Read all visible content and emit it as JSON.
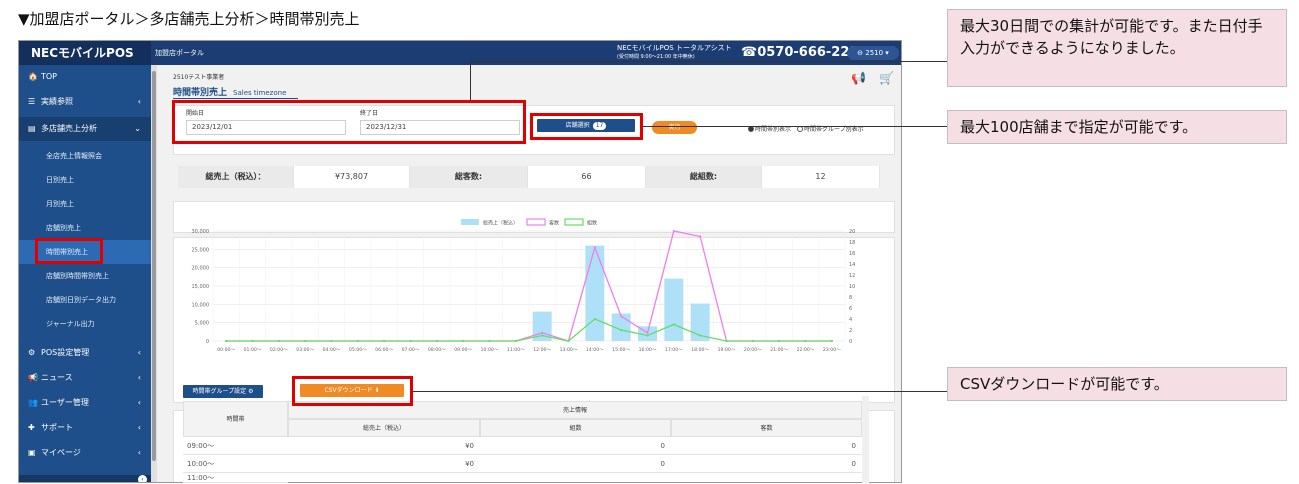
{
  "page_caption": "▼加盟店ポータル＞多店舗売上分析＞時間帯別売上",
  "app": {
    "brand": "NECモバイルPOS",
    "portal_label": "加盟店ポータル",
    "assist_title": "NECモバイルPOS トータルアシスト",
    "assist_sub": "(受付時間 9:00〜21:00 年中無休)",
    "phone": "☎0570-666-221",
    "user_menu": "⊖ 2510 ▾"
  },
  "sidebar": {
    "items": [
      {
        "icon": "🏠",
        "label": "TOP",
        "chevron": ""
      },
      {
        "icon": "☰",
        "label": "実績参照",
        "chevron": "‹"
      },
      {
        "icon": "▤",
        "label": "多店舗売上分析",
        "chevron": "⌄"
      },
      {
        "icon": "⚙",
        "label": "POS設定管理",
        "chevron": "‹"
      },
      {
        "icon": "📢",
        "label": "ニュース",
        "chevron": "‹"
      },
      {
        "icon": "👥",
        "label": "ユーザー管理",
        "chevron": "‹"
      },
      {
        "icon": "✚",
        "label": "サポート",
        "chevron": "‹"
      },
      {
        "icon": "▣",
        "label": "マイページ",
        "chevron": "‹"
      }
    ],
    "sub_items": [
      "全店売上情報照会",
      "日別売上",
      "月別売上",
      "店舗別売上",
      "時間帯別売上",
      "店舗別時間帯別売上",
      "店舗別日別データ出力",
      "ジャーナル出力"
    ],
    "collapse_icon": "‹"
  },
  "content": {
    "breadcrumb": "2510テスト事業者",
    "title": "時間帯別売上",
    "title_en": "Sales timezone",
    "start_label": "開始日",
    "start_value": "2023/12/01",
    "end_label": "終了日",
    "end_value": "2023/12/31",
    "store_button": "店舗選択",
    "store_count": "17",
    "exec_button": "実行",
    "radio_1": "時間帯別表示",
    "radio_2": "時間帯グループ別表示"
  },
  "stats": {
    "sales_label": "総売上（税込）：",
    "sales_value": "¥73,807",
    "customers_label": "総客数:",
    "customers_value": "66",
    "groups_label": "総組数:",
    "groups_value": "12"
  },
  "chart_data": {
    "type": "bar",
    "categories": [
      "00:00〜",
      "01:00〜",
      "02:00〜",
      "03:00〜",
      "04:00〜",
      "05:00〜",
      "06:00〜",
      "07:00〜",
      "08:00〜",
      "09:00〜",
      "10:00〜",
      "11:00〜",
      "12:00〜",
      "13:00〜",
      "14:00〜",
      "15:00〜",
      "16:00〜",
      "17:00〜",
      "18:00〜",
      "19:00〜",
      "20:00〜",
      "21:00〜",
      "22:00〜",
      "23:00〜"
    ],
    "series": [
      {
        "name": "総売上（税込）",
        "type": "bar",
        "axis": "left",
        "color": "#aee0f7",
        "values": [
          0,
          0,
          0,
          0,
          0,
          0,
          0,
          0,
          0,
          0,
          0,
          0,
          8000,
          0,
          26000,
          7500,
          4000,
          17000,
          10200,
          0,
          0,
          0,
          0,
          0
        ]
      },
      {
        "name": "客数",
        "type": "line",
        "axis": "right",
        "color": "#f07ee8",
        "values": [
          0,
          0,
          0,
          0,
          0,
          0,
          0,
          0,
          0,
          0,
          0,
          0,
          1.5,
          0,
          17,
          4.5,
          1.5,
          20,
          19,
          0,
          0,
          0,
          0,
          0
        ]
      },
      {
        "name": "組数",
        "type": "line",
        "axis": "right",
        "color": "#66dd66",
        "values": [
          0,
          0,
          0,
          0,
          0,
          0,
          0,
          0,
          0,
          0,
          0,
          0,
          1,
          0,
          4,
          2,
          1,
          3,
          1,
          0,
          0,
          0,
          0,
          0
        ]
      }
    ],
    "ylim": [
      0,
      30000
    ],
    "y2lim": [
      0,
      20
    ],
    "yticks": [
      "0",
      "5,000",
      "10,000",
      "15,000",
      "20,000",
      "25,000",
      "30,000"
    ],
    "y2ticks": [
      "0",
      "2",
      "4",
      "6",
      "8",
      "10",
      "12",
      "14",
      "16",
      "18",
      "20"
    ],
    "legend": "top-center"
  },
  "actions": {
    "group_setting": "時間帯グループ設定 ⚙",
    "csv_download": "CSVダウンロード ⬇"
  },
  "table": {
    "col_time": "時間帯",
    "group_header": "売上情報",
    "col_sales": "総売上（税込）",
    "col_groups": "組数",
    "col_customers": "客数",
    "rows": [
      {
        "time": "09:00〜",
        "sales": "¥0",
        "groups": "0",
        "customers": "0"
      },
      {
        "time": "10:00〜",
        "sales": "¥0",
        "groups": "0",
        "customers": "0"
      },
      {
        "time": "11:00〜",
        "sales": "",
        "groups": "",
        "customers": ""
      }
    ]
  },
  "notes": {
    "note1": "最大30日間での集計が可能です。また日付手入力ができるようになりました。",
    "note2": "最大100店舗まで指定が可能です。",
    "note3": "CSVダウンロードが可能です。"
  }
}
